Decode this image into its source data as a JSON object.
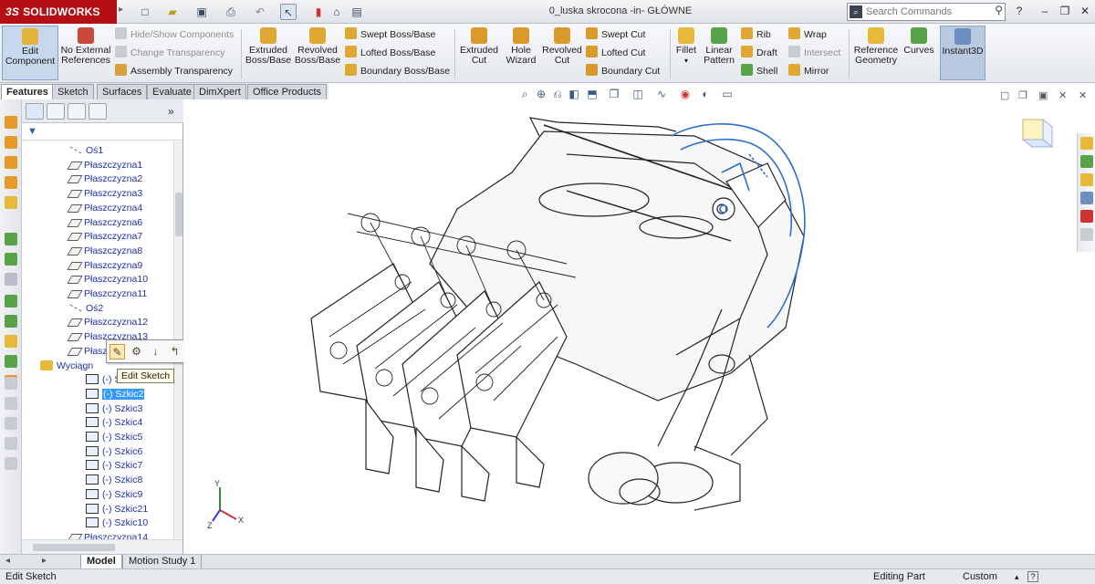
{
  "app": {
    "brand_prefix": "3S",
    "brand_name": "SOLIDWORKS"
  },
  "document_title": "0_luska skrocona -in- GŁÓWNE",
  "search": {
    "placeholder": "Search Commands"
  },
  "window_controls": {
    "help": "?",
    "minimize": "–",
    "restore": "❐",
    "close": "✕"
  },
  "commands": {
    "edit_component": "Edit Component",
    "no_external_references": "No External References",
    "hide_show_components": "Hide/Show Components",
    "change_transparency": "Change Transparency",
    "assembly_transparency": "Assembly Transparency",
    "extruded_boss": "Extruded Boss/Base",
    "revolved_boss": "Revolved Boss/Base",
    "swept_boss": "Swept Boss/Base",
    "lofted_boss": "Lofted Boss/Base",
    "boundary_boss": "Boundary Boss/Base",
    "extruded_cut": "Extruded Cut",
    "hole_wizard": "Hole Wizard",
    "revolved_cut": "Revolved Cut",
    "swept_cut": "Swept Cut",
    "lofted_cut": "Lofted Cut",
    "boundary_cut": "Boundary Cut",
    "fillet": "Fillet",
    "linear_pattern": "Linear Pattern",
    "rib": "Rib",
    "draft": "Draft",
    "shell": "Shell",
    "wrap": "Wrap",
    "intersect": "Intersect",
    "mirror": "Mirror",
    "reference_geometry": "Reference Geometry",
    "curves": "Curves",
    "instant3d": "Instant3D"
  },
  "command_tabs": [
    "Features",
    "Sketch",
    "Surfaces",
    "Evaluate",
    "DimXpert",
    "Office Products"
  ],
  "feature_tree": {
    "items": [
      {
        "label": "Oś1",
        "type": "axis",
        "indent": 1
      },
      {
        "label": "Płaszczyzna1",
        "type": "plane",
        "indent": 1
      },
      {
        "label": "Płaszczyzna2",
        "type": "plane",
        "indent": 1
      },
      {
        "label": "Płaszczyzna3",
        "type": "plane",
        "indent": 1
      },
      {
        "label": "Płaszczyzna4",
        "type": "plane",
        "indent": 1
      },
      {
        "label": "Płaszczyzna6",
        "type": "plane",
        "indent": 1
      },
      {
        "label": "Płaszczyzna7",
        "type": "plane",
        "indent": 1
      },
      {
        "label": "Płaszczyzna8",
        "type": "plane",
        "indent": 1
      },
      {
        "label": "Płaszczyzna9",
        "type": "plane",
        "indent": 1
      },
      {
        "label": "Płaszczyzna10",
        "type": "plane",
        "indent": 1
      },
      {
        "label": "Płaszczyzna11",
        "type": "plane",
        "indent": 1
      },
      {
        "label": "Oś2",
        "type": "axis",
        "indent": 1
      },
      {
        "label": "Płaszczyzna12",
        "type": "plane",
        "indent": 1
      },
      {
        "label": "Płaszczyzna13",
        "type": "plane",
        "indent": 1
      },
      {
        "label": "Płaszczy",
        "type": "plane",
        "indent": 1
      },
      {
        "label": "Wyciągn",
        "type": "feature",
        "indent": 0
      },
      {
        "label": "(-) Sz",
        "type": "sketch",
        "indent": 2
      },
      {
        "label": "(-) Szkic2",
        "type": "sketch",
        "indent": 2,
        "selected": true
      },
      {
        "label": "(-) Szkic3",
        "type": "sketch",
        "indent": 2
      },
      {
        "label": "(-) Szkic4",
        "type": "sketch",
        "indent": 2
      },
      {
        "label": "(-) Szkic5",
        "type": "sketch",
        "indent": 2
      },
      {
        "label": "(-) Szkic6",
        "type": "sketch",
        "indent": 2
      },
      {
        "label": "(-) Szkic7",
        "type": "sketch",
        "indent": 2
      },
      {
        "label": "(-) Szkic8",
        "type": "sketch",
        "indent": 2
      },
      {
        "label": "(-) Szkic9",
        "type": "sketch",
        "indent": 2
      },
      {
        "label": "(-) Szkic21",
        "type": "sketch",
        "indent": 2
      },
      {
        "label": "(-) Szkic10",
        "type": "sketch",
        "indent": 2
      },
      {
        "label": "Płaszczyzna14",
        "type": "plane",
        "indent": 1
      }
    ]
  },
  "tooltip": "Edit Sketch",
  "bottom_tabs": [
    "Model",
    "Motion Study 1"
  ],
  "status": {
    "left": "Edit Sketch",
    "mode": "Editing Part",
    "units": "Custom",
    "help": "?"
  },
  "triad": {
    "x": "X",
    "y": "Y",
    "z": "Z"
  },
  "colors": {
    "brand_red": "#b40f14",
    "tree_text": "#1f2fa8",
    "selection": "#3399ff",
    "sketch_blue": "#2a6fd0"
  }
}
